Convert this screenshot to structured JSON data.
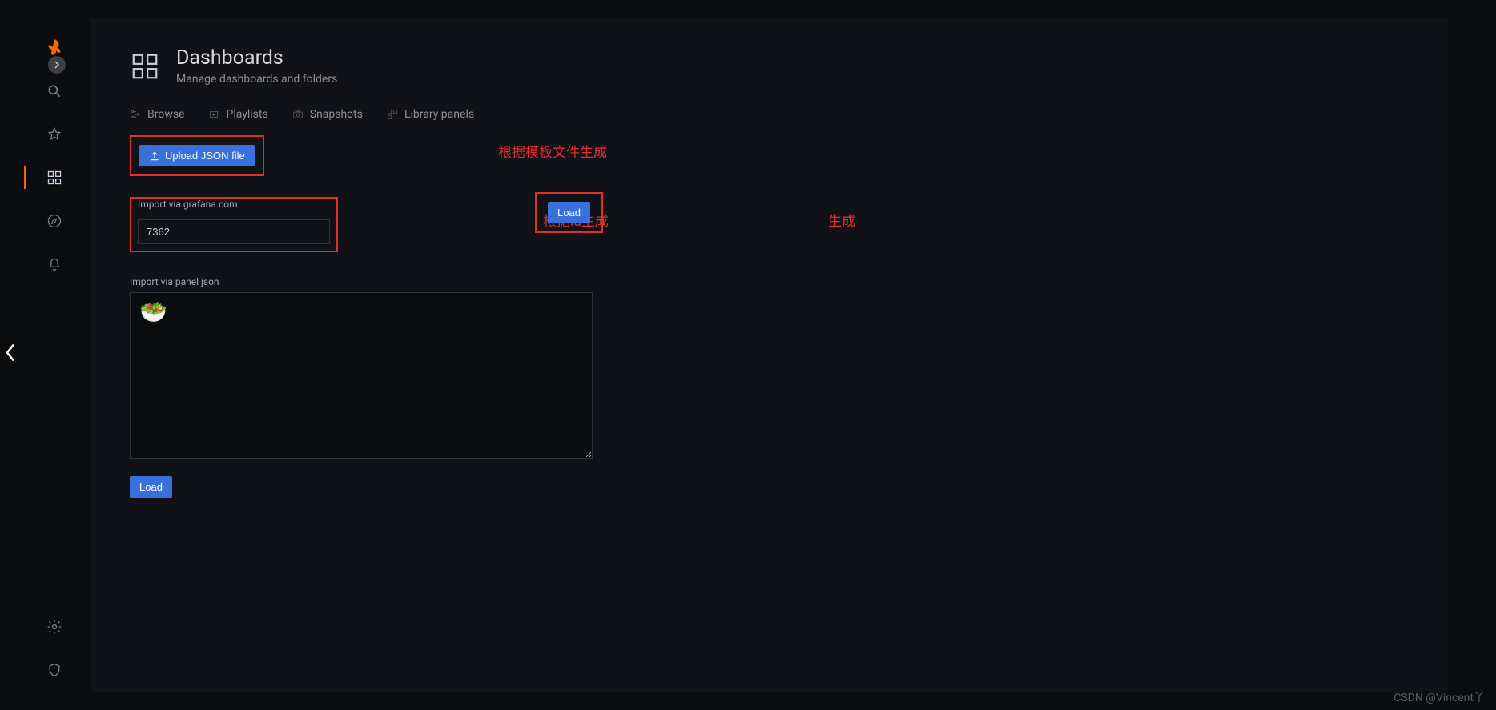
{
  "header": {
    "title": "Dashboards",
    "subtitle": "Manage dashboards and folders"
  },
  "tabs": {
    "browse": "Browse",
    "playlists": "Playlists",
    "snapshots": "Snapshots",
    "library": "Library panels"
  },
  "form": {
    "upload_label": "Upload JSON file",
    "grafana_import_label": "Import via grafana.com",
    "grafana_id_value": "7362",
    "load_label": "Load",
    "panel_json_label": "Import via panel json",
    "load_json_label": "Load"
  },
  "annotations": {
    "upload": "根据模板文件生成",
    "id": "根据id生成",
    "load": "生成"
  },
  "watermark": "CSDN @Vincent丫"
}
